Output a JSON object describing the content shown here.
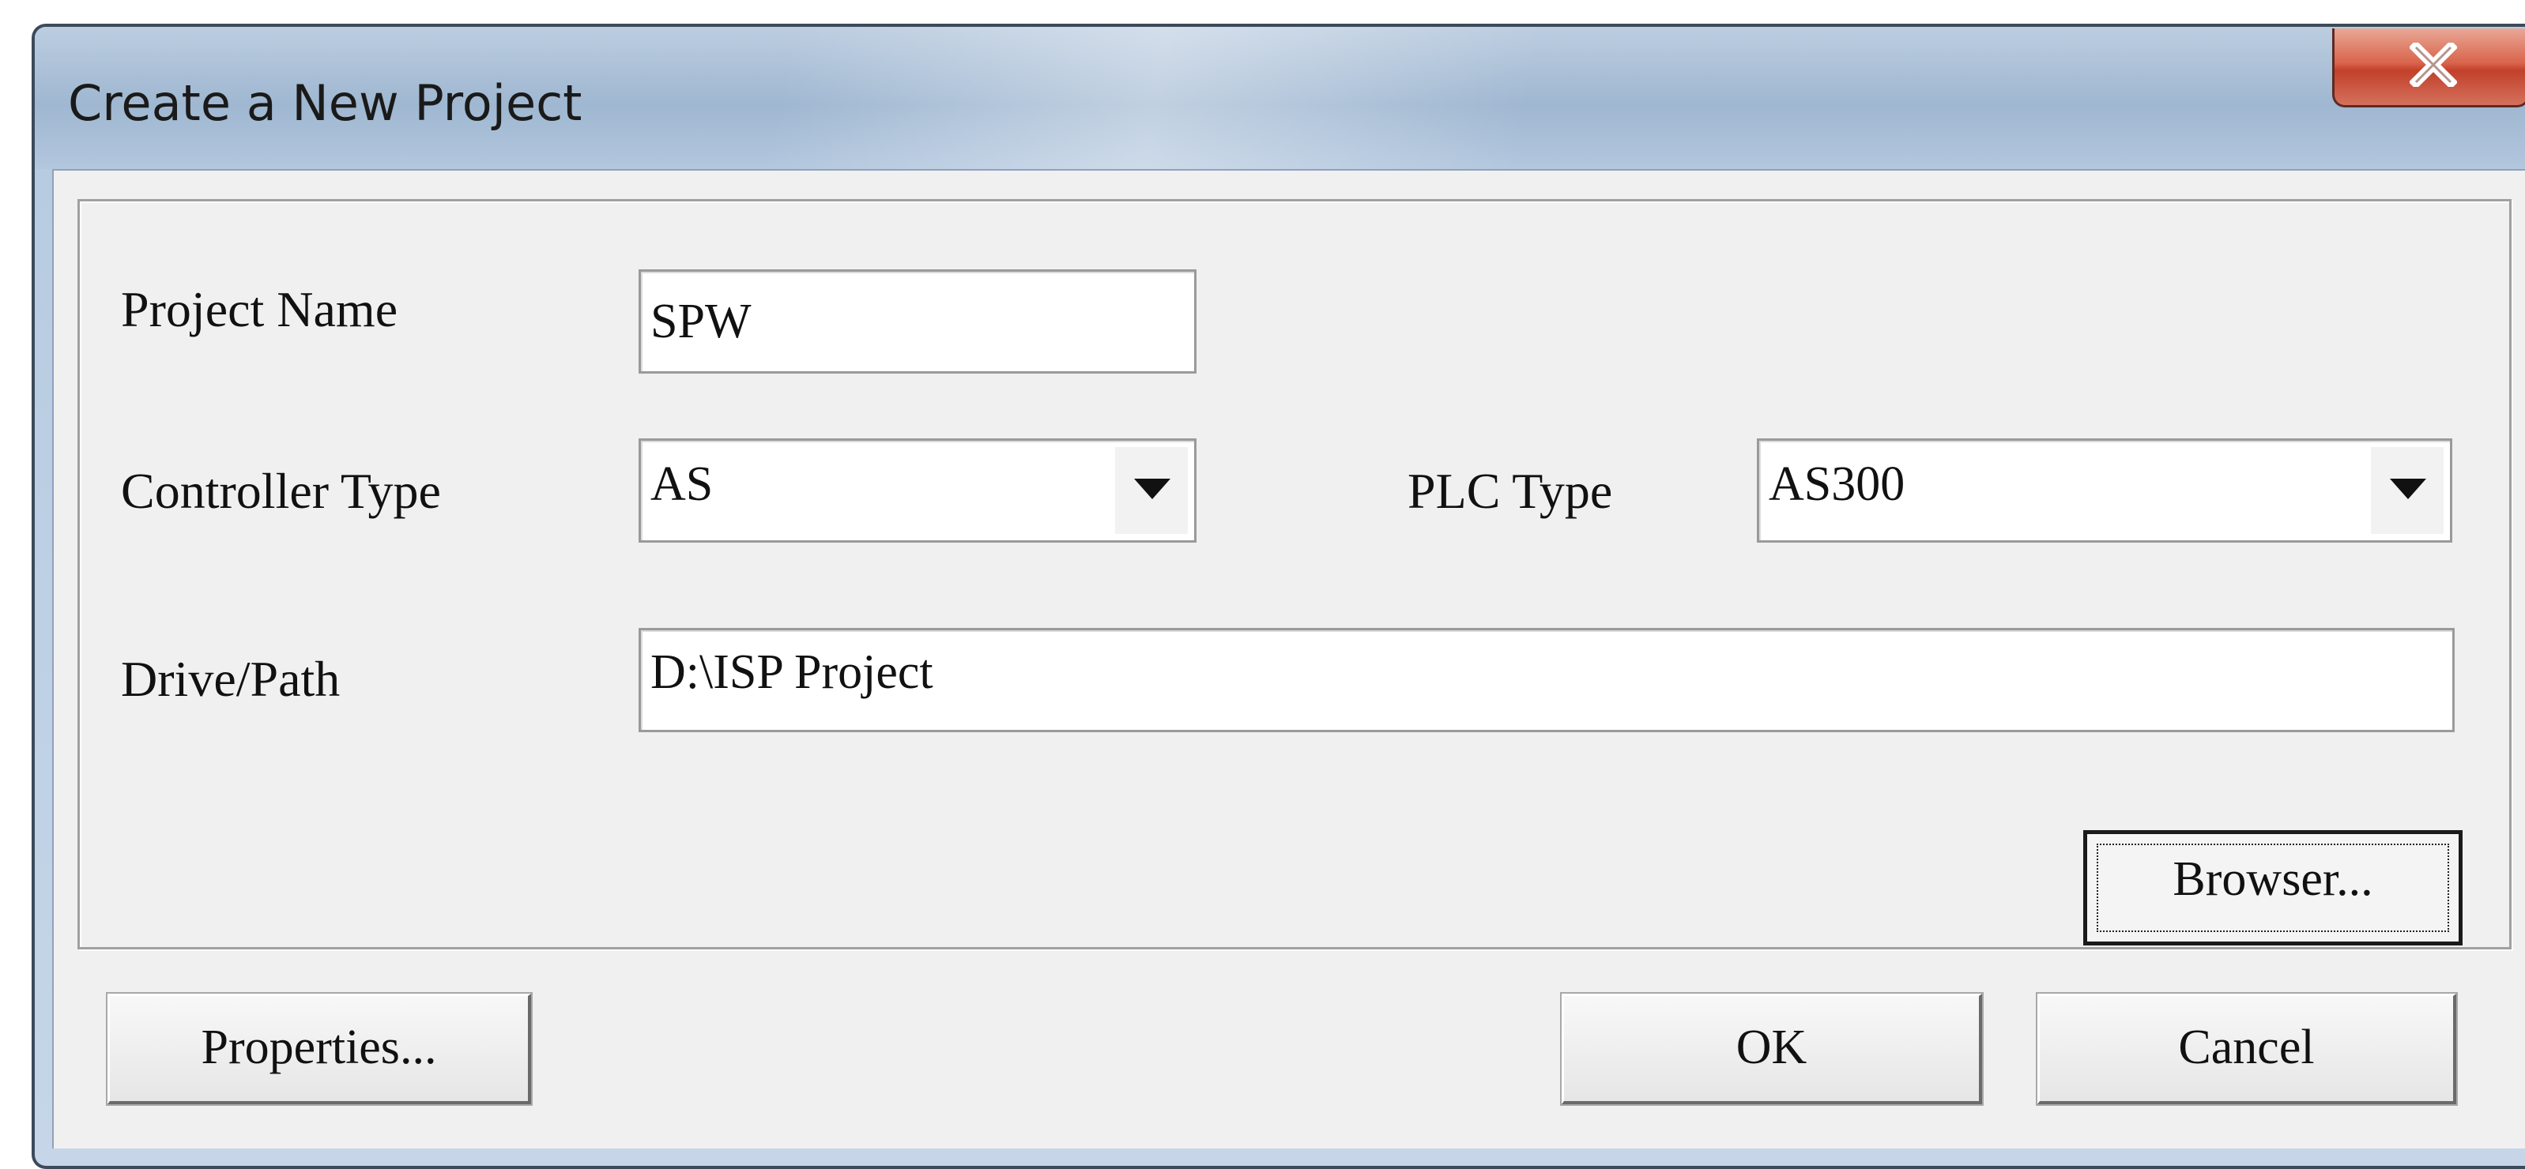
{
  "window": {
    "title": "Create a New Project",
    "close_icon": "close-icon"
  },
  "form": {
    "project_name_label": "Project Name",
    "project_name_value": "SPW",
    "controller_type_label": "Controller Type",
    "controller_type_value": "AS",
    "plc_type_label": "PLC Type",
    "plc_type_value": "AS300",
    "drive_path_label": "Drive/Path",
    "drive_path_value": "D:\\ISP Project",
    "browser_label": "Browser..."
  },
  "footer": {
    "properties_label": "Properties...",
    "ok_label": "OK",
    "cancel_label": "Cancel"
  },
  "colors": {
    "close_button": "#d9644c",
    "client_background": "#f0f0f0",
    "title_bar": "#a9bfd8"
  }
}
